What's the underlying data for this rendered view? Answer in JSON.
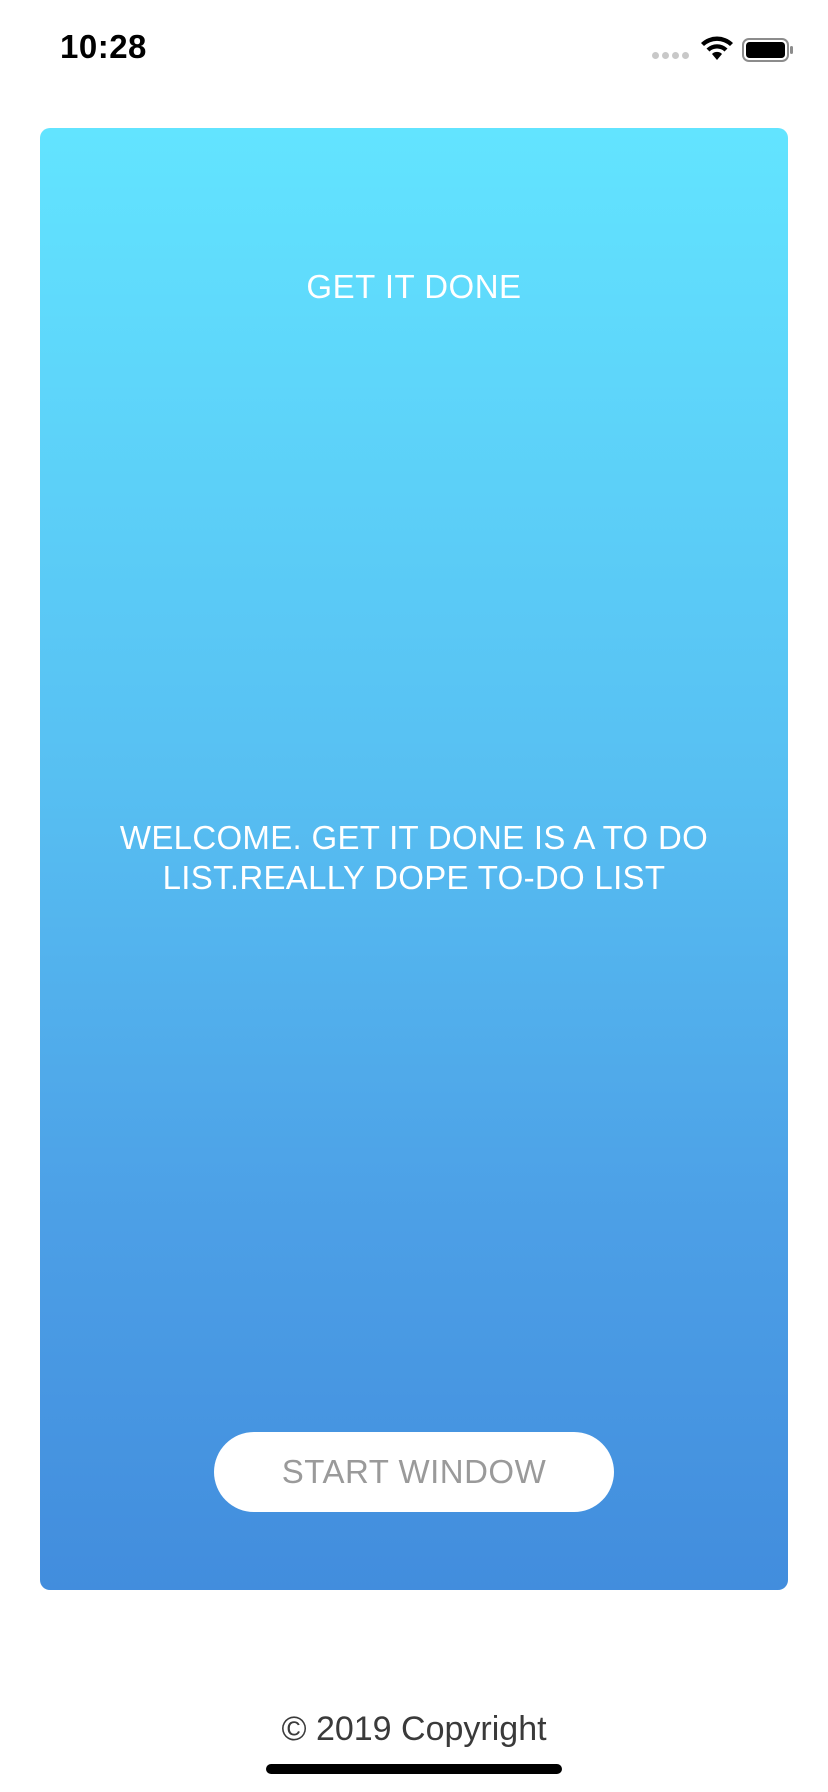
{
  "status_bar": {
    "time": "10:28",
    "icons": [
      "signal-dots-icon",
      "wifi-icon",
      "battery-icon"
    ]
  },
  "card": {
    "title": "GET IT DONE",
    "welcome": "WELCOME. GET IT DONE IS A TO DO LIST.REALLY DOPE TO-DO LIST",
    "gradient_top_color": "#62e4ff",
    "gradient_bottom_color": "#428ddd"
  },
  "start_button": {
    "label": "START WINDOW"
  },
  "footer": {
    "copyright": "© 2019 Copyright"
  }
}
